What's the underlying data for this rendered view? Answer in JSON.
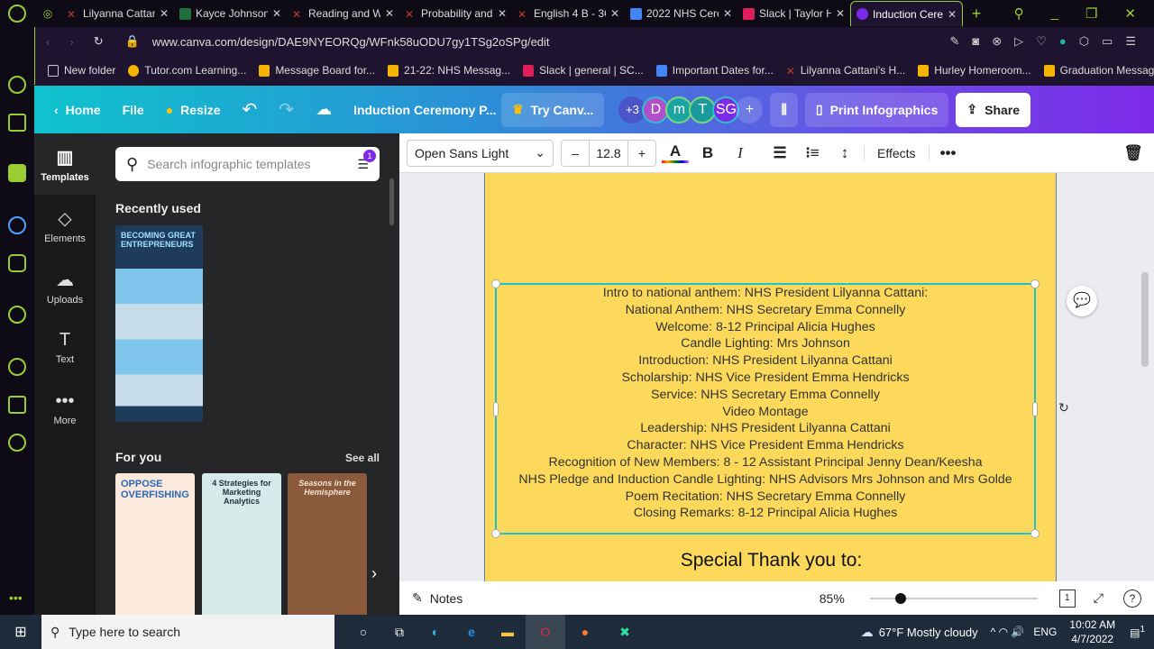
{
  "browser": {
    "tabs": [
      {
        "title": "Lilyanna Cattan",
        "color": "#c0392b"
      },
      {
        "title": "Kayce Johnson",
        "color": "#1e6f3a"
      },
      {
        "title": "Reading and W",
        "color": "#c0392b"
      },
      {
        "title": "Probability and",
        "color": "#c0392b"
      },
      {
        "title": "English 4 B - 3C",
        "color": "#c0392b"
      },
      {
        "title": "2022 NHS Cere",
        "color": "#4285f4"
      },
      {
        "title": "Slack | Taylor H",
        "color": "#e01e5a"
      },
      {
        "title": "Induction Cere",
        "color": "#7d2ae8"
      }
    ],
    "url": "www.canva.com/design/DAE9NYEORQg/WFnk58uODU7gy1TSg2oSPg/edit",
    "bookmarks": [
      "New folder",
      "Tutor.com Learning...",
      "Message Board for...",
      "21-22: NHS Messag...",
      "Slack | general | SC...",
      "Important Dates for...",
      "Lilyanna Cattani's H...",
      "Hurley Homeroom...",
      "Graduation Messag..."
    ]
  },
  "header": {
    "home": "Home",
    "file": "File",
    "resize": "Resize",
    "title": "Induction Ceremony P...",
    "try": "Try Canv...",
    "more_collab": "+3",
    "avatars": [
      "D",
      "m",
      "T",
      "SG"
    ],
    "print": "Print Infographics",
    "share": "Share"
  },
  "rail": [
    {
      "label": "Templates",
      "icon": "▥"
    },
    {
      "label": "Elements",
      "icon": "◇"
    },
    {
      "label": "Uploads",
      "icon": "☁"
    },
    {
      "label": "Text",
      "icon": "T"
    },
    {
      "label": "More",
      "icon": "•••"
    }
  ],
  "panel": {
    "search_placeholder": "Search infographic templates",
    "filter_badge": "1",
    "recently_used": "Recently used",
    "for_you": "For you",
    "see_all": "See all",
    "templates": [
      "BECOMING GREAT ENTREPRENEURS",
      "OPPOSE OVERFISHING",
      "4 Strategies for Marketing Analytics",
      "Seasons in the Hemisphere"
    ]
  },
  "toolbar": {
    "font": "Open Sans Light",
    "size": "12.8",
    "effects": "Effects"
  },
  "document": {
    "lines": [
      "Intro to national anthem: NHS President Lilyanna Cattani:",
      "National Anthem: NHS Secretary Emma Connelly",
      "Welcome: 8-12 Principal Alicia Hughes",
      "Candle Lighting: Mrs Johnson",
      "Introduction: NHS President Lilyanna Cattani",
      "Scholarship: NHS Vice President Emma Hendricks",
      "Service: NHS Secretary Emma Connelly",
      "Video Montage",
      "Leadership: NHS President Lilyanna Cattani",
      "Character: NHS Vice President Emma Hendricks",
      "Recognition of New Members: 8 - 12 Assistant Principal Jenny Dean/Keesha",
      "NHS Pledge and Induction Candle Lighting: NHS Advisors Mrs Johnson and Mrs Golde",
      "Poem Recitation: NHS Secretary Emma Connelly",
      "Closing Remarks: 8-12 Principal Alicia Hughes"
    ],
    "thanks": "Special Thank you to:"
  },
  "bottom": {
    "notes": "Notes",
    "zoom": "85%",
    "zoom_fraction": 0.15,
    "page": "1"
  },
  "taskbar": {
    "search": "Type here to search",
    "weather": "67°F  Mostly cloudy",
    "lang": "ENG",
    "time": "10:02 AM",
    "date": "4/7/2022",
    "notif": "1"
  }
}
